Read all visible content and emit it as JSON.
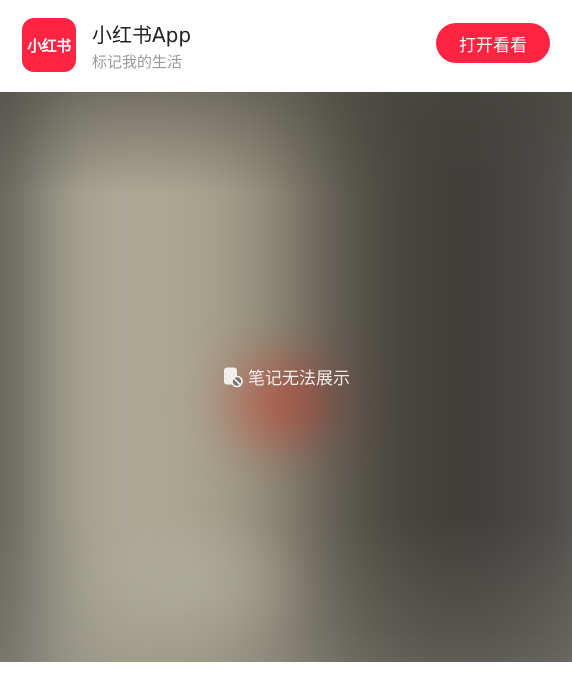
{
  "banner": {
    "logo_text": "小红书",
    "app_name": "小红书App",
    "slogan": "标记我的生活",
    "open_button": "打开看看"
  },
  "media": {
    "notice_icon": "note-unavailable-icon",
    "notice_text": "笔记无法展示"
  },
  "colors": {
    "brand": "#ff2442",
    "text_primary": "#222222",
    "text_secondary": "#999999"
  }
}
